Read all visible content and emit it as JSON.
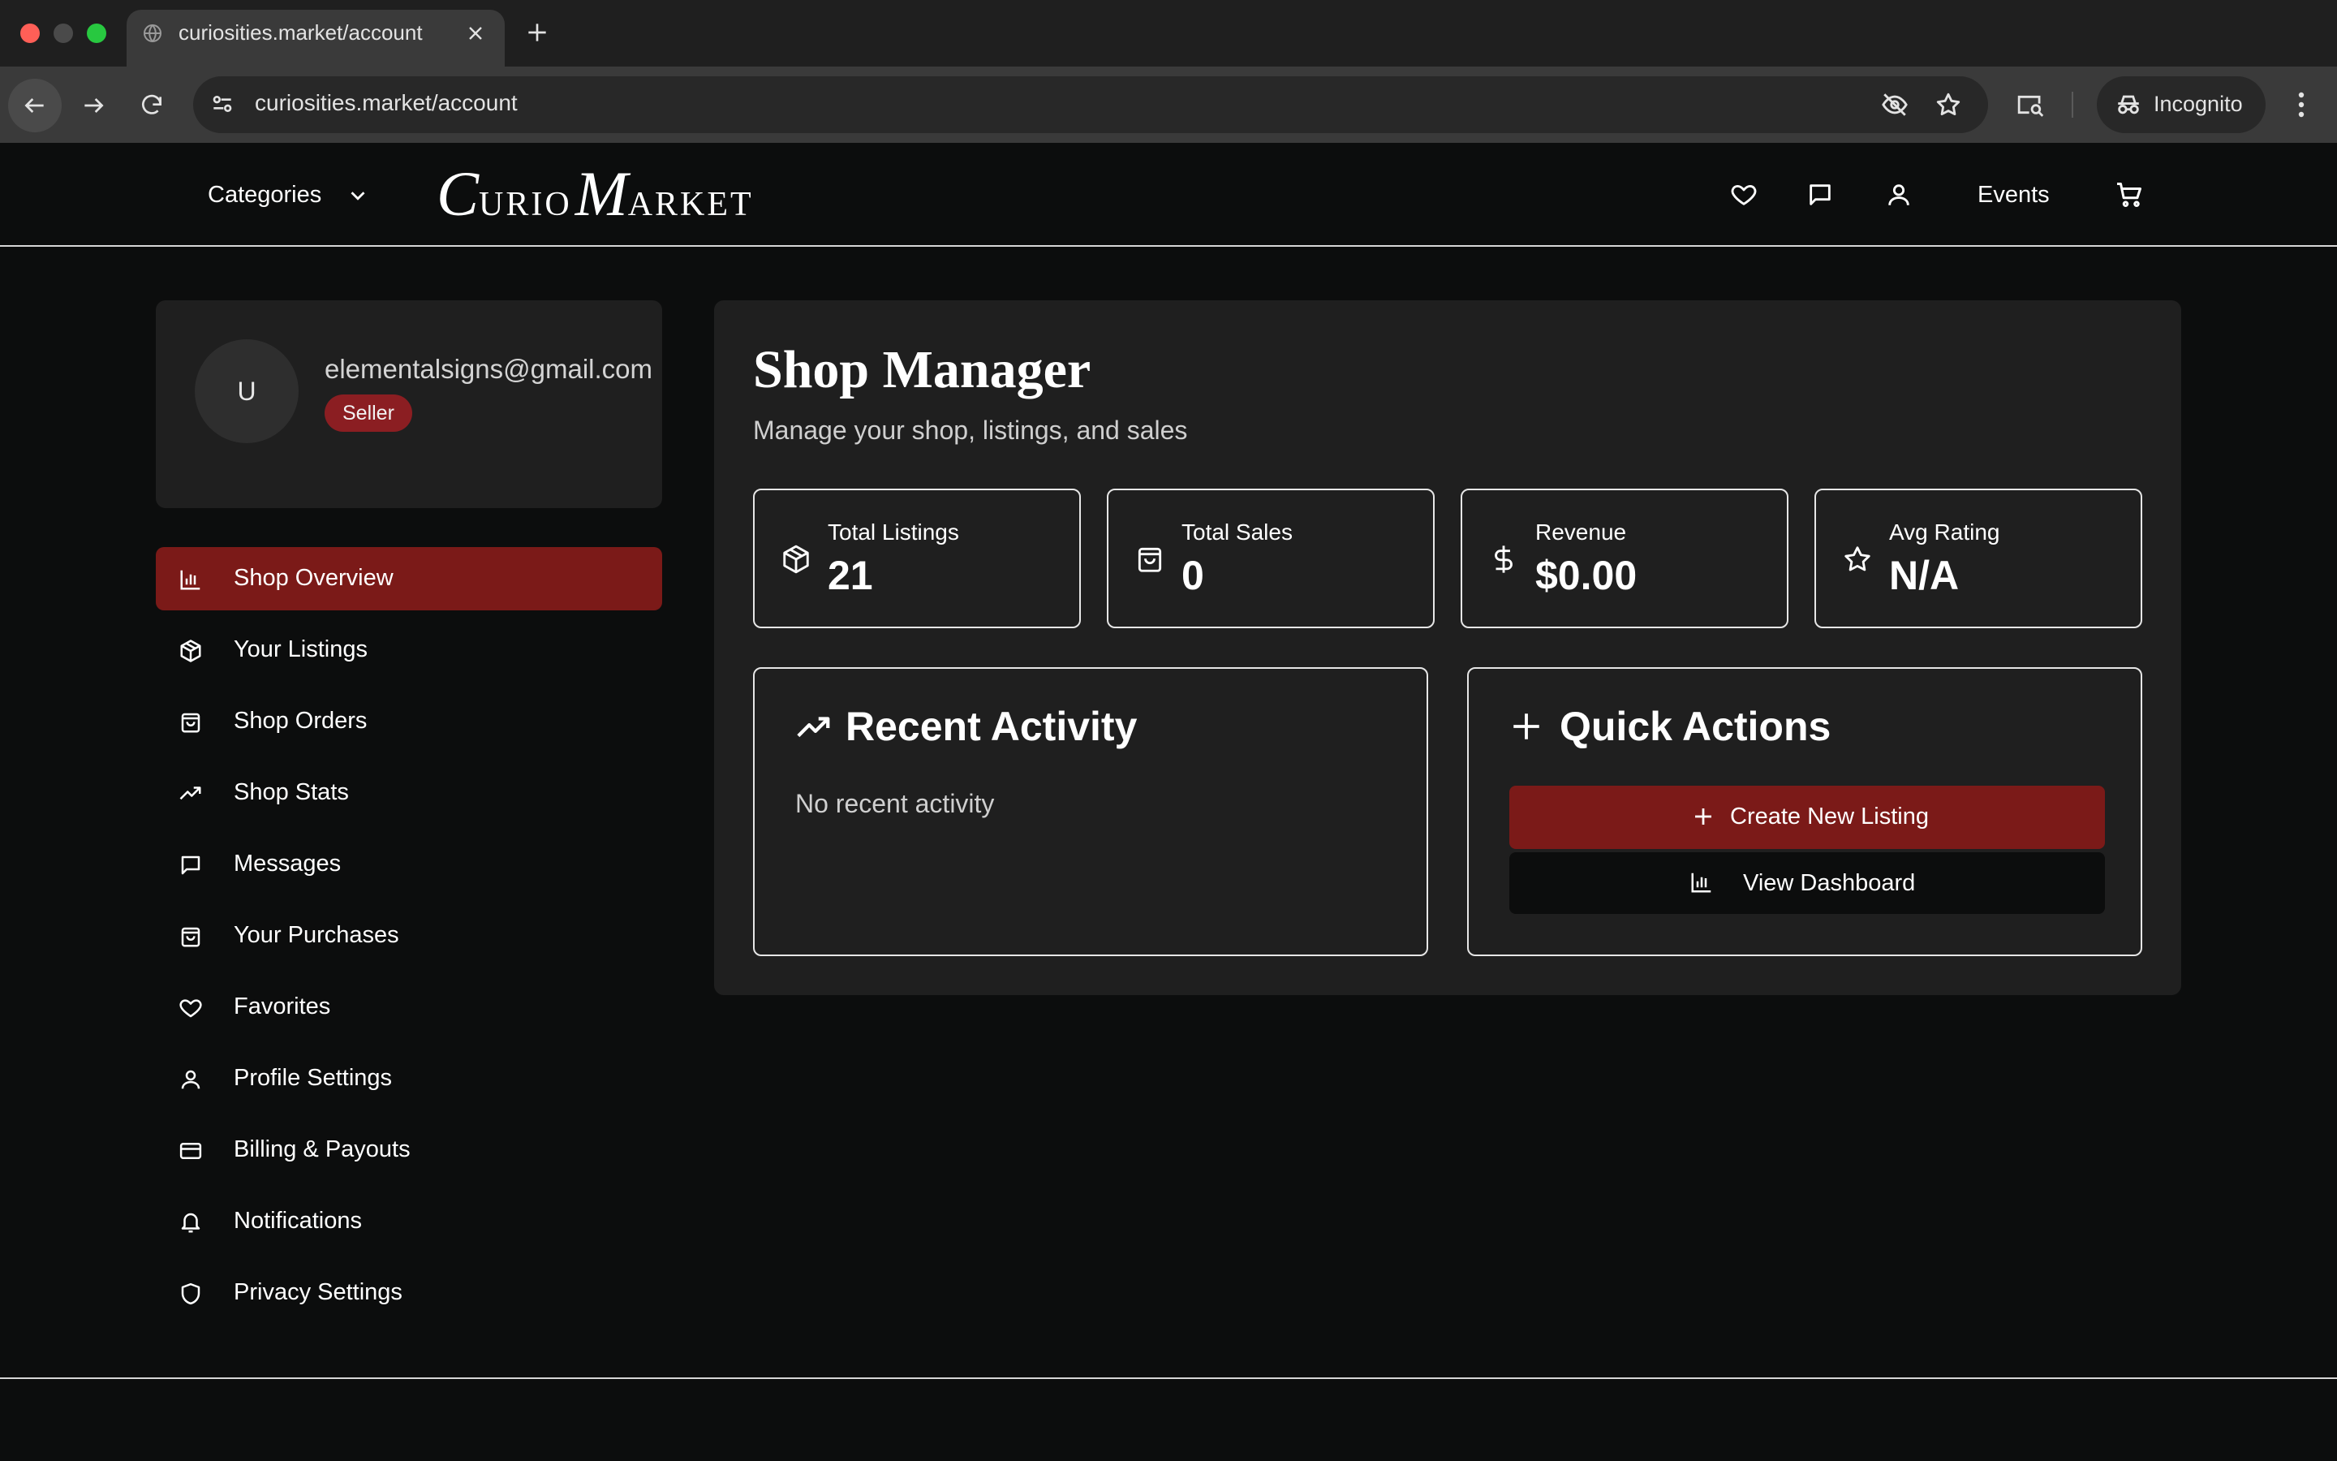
{
  "browser": {
    "tab_title": "curiosities.market/account",
    "url": "curiosities.market/account",
    "incognito_label": "Incognito"
  },
  "header": {
    "categories_label": "Categories",
    "logo": {
      "c": "C",
      "urio": "URIO",
      "m": "M",
      "arket": "ARKET"
    },
    "events_label": "Events"
  },
  "profile": {
    "avatar_initial": "U",
    "email": "elementalsigns@gmail.com",
    "badge": "Seller"
  },
  "sidebar": {
    "items": [
      {
        "label": "Shop Overview",
        "icon": "bar-chart-icon",
        "active": true
      },
      {
        "label": "Your Listings",
        "icon": "package-icon"
      },
      {
        "label": "Shop Orders",
        "icon": "shopping-bag-icon"
      },
      {
        "label": "Shop Stats",
        "icon": "trending-up-icon"
      },
      {
        "label": "Messages",
        "icon": "message-icon"
      },
      {
        "label": "Your Purchases",
        "icon": "shopping-bag-icon"
      },
      {
        "label": "Favorites",
        "icon": "heart-icon"
      },
      {
        "label": "Profile Settings",
        "icon": "user-icon"
      },
      {
        "label": "Billing & Payouts",
        "icon": "credit-card-icon"
      },
      {
        "label": "Notifications",
        "icon": "bell-icon"
      },
      {
        "label": "Privacy Settings",
        "icon": "shield-icon"
      }
    ]
  },
  "main": {
    "title": "Shop Manager",
    "subtitle": "Manage your shop, listings, and sales",
    "stats": [
      {
        "label": "Total Listings",
        "value": "21",
        "icon": "package-icon"
      },
      {
        "label": "Total Sales",
        "value": "0",
        "icon": "shopping-bag-icon"
      },
      {
        "label": "Revenue",
        "value": "$0.00",
        "icon": "dollar-icon"
      },
      {
        "label": "Avg Rating",
        "value": "N/A",
        "icon": "star-icon"
      }
    ],
    "recent_activity": {
      "title": "Recent Activity",
      "empty_text": "No recent activity"
    },
    "quick_actions": {
      "title": "Quick Actions",
      "create_label": "Create New Listing",
      "dashboard_label": "View Dashboard"
    }
  },
  "colors": {
    "accent": "#7b1a18",
    "badge": "#8b1e22",
    "background": "#0c0d0d",
    "panel": "#1f1f1f"
  }
}
